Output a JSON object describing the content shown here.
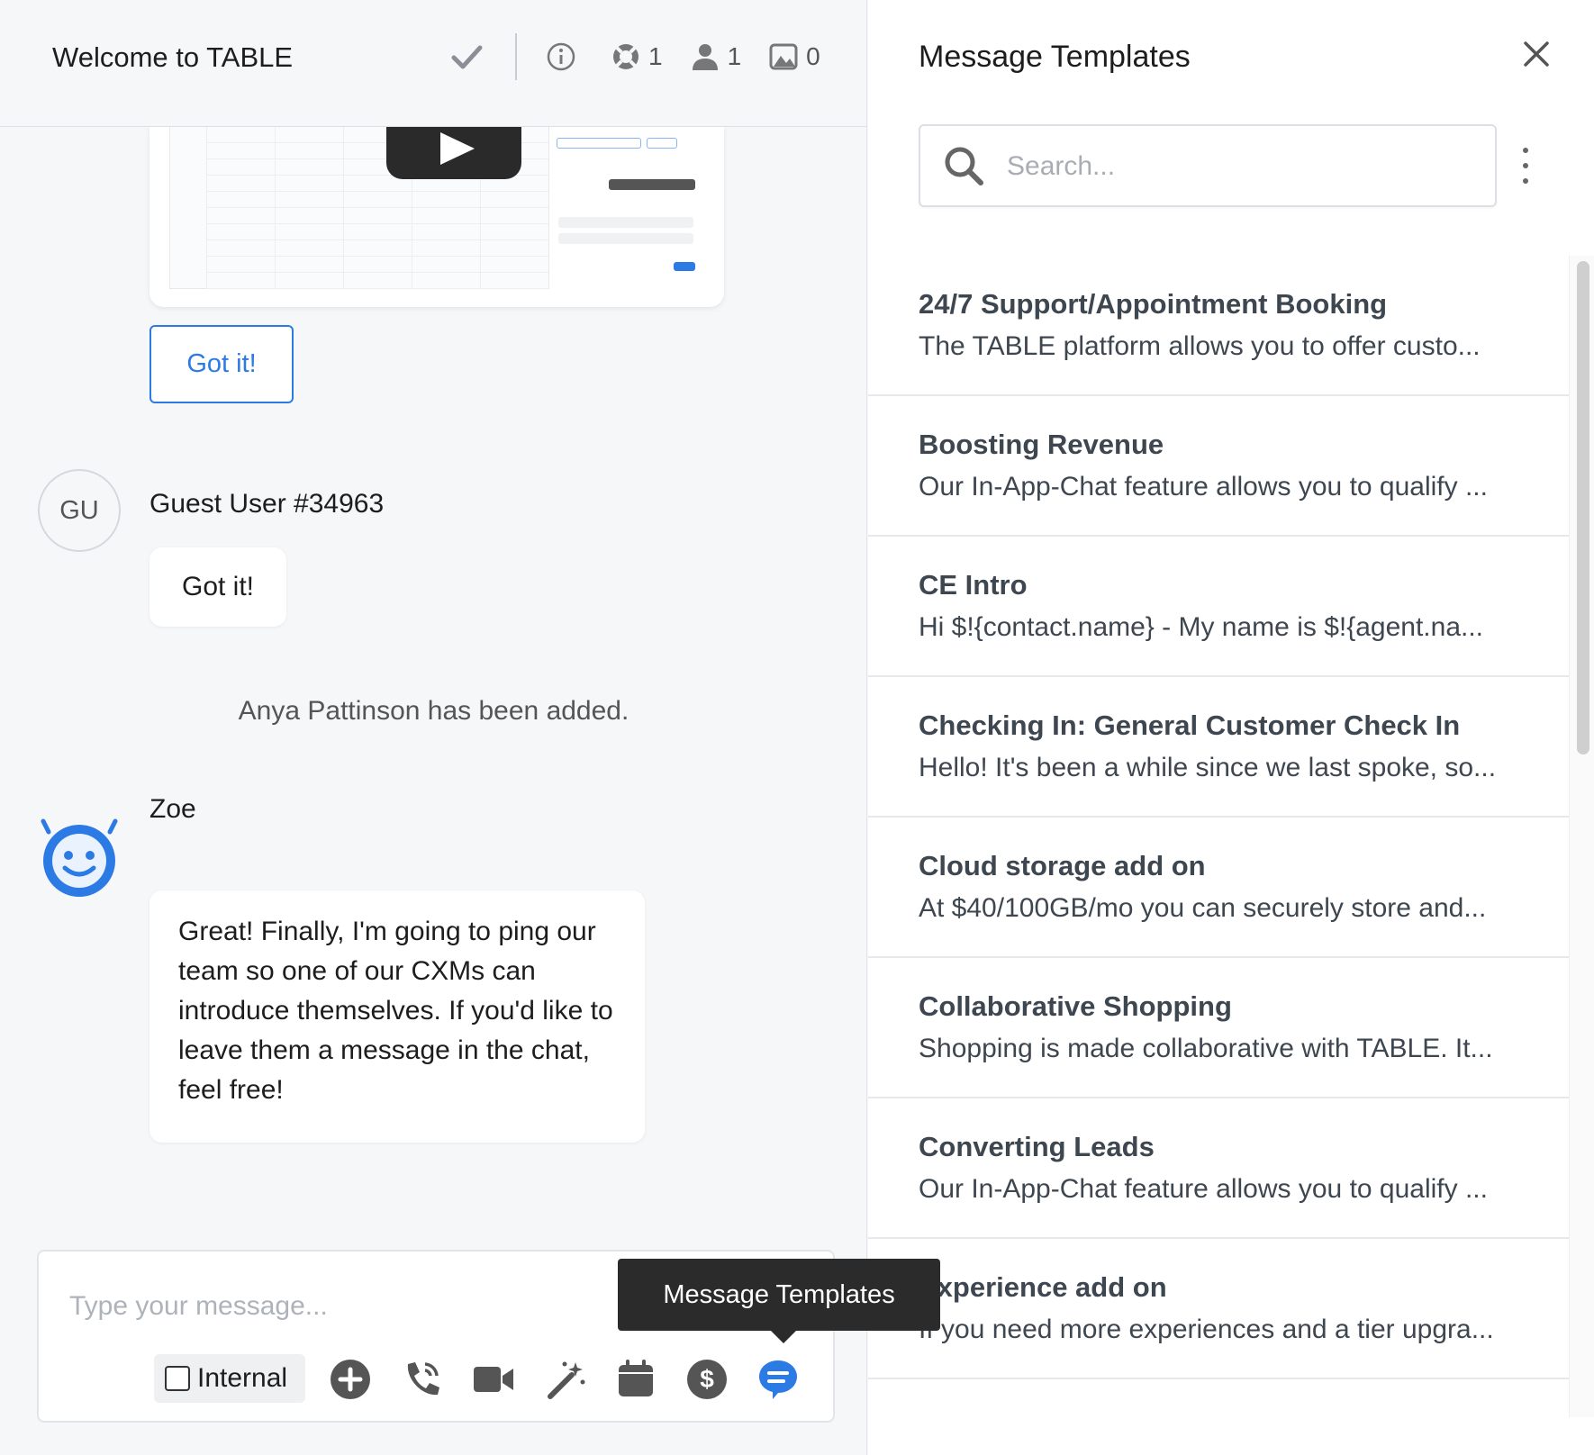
{
  "chat": {
    "title": "Welcome to TABLE",
    "header": {
      "tickets_count": "1",
      "participants_count": "1",
      "media_count": "0"
    },
    "got_it_button": "Got it!",
    "guest": {
      "initials": "GU",
      "name": "Guest User #34963",
      "message": "Got it!"
    },
    "system_message": "Anya Pattinson has been added.",
    "bot": {
      "name": "Zoe",
      "message": "Great! Finally, I'm going to ping our team so one of our CXMs can introduce themselves. If you'd like to leave them a message in the chat, feel free!"
    },
    "composer": {
      "placeholder": "Type your message...",
      "internal_label": "Internal",
      "internal_checked": false,
      "tools": [
        "plus-icon",
        "phone-icon",
        "video-icon",
        "magic-wand-icon",
        "calendar-icon",
        "dollar-icon",
        "message-templates-icon"
      ]
    },
    "tooltip": "Message Templates",
    "accent_color": "#2c7be5"
  },
  "templates": {
    "title": "Message Templates",
    "search_placeholder": "Search...",
    "items": [
      {
        "title": "24/7 Support/Appointment Booking",
        "snippet": "The TABLE platform allows you to offer custo..."
      },
      {
        "title": "Boosting Revenue",
        "snippet": "Our In-App-Chat feature allows you to qualify ..."
      },
      {
        "title": "CE Intro",
        "snippet": "Hi $!{contact.name} - My name is $!{agent.na..."
      },
      {
        "title": "Checking In: General Customer Check In",
        "snippet": "Hello! It's been a while since we last spoke, so..."
      },
      {
        "title": "Cloud storage add on",
        "snippet": "At $40/100GB/mo you can securely store and..."
      },
      {
        "title": "Collaborative Shopping",
        "snippet": "Shopping is made collaborative with TABLE. It..."
      },
      {
        "title": "Converting Leads",
        "snippet": "Our In-App-Chat feature allows you to qualify ..."
      },
      {
        "title": "Experience add on",
        "snippet": "If you need more experiences and a tier upgra..."
      }
    ]
  }
}
